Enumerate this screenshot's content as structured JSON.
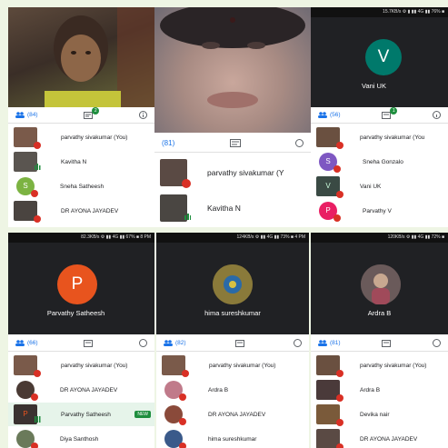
{
  "colors": {
    "meet_blue": "#1a73e8",
    "meet_green": "#1e8e3e",
    "mute_red": "#d93025",
    "avatar_teal": "#00796b",
    "avatar_orange": "#e8541e",
    "avatar_purple": "#7e57c2",
    "avatar_pink": "#e91e63",
    "avatar_lightgreen": "#7cb342"
  },
  "icons": {
    "people": "people-icon",
    "chat": "chat-icon",
    "info": "info-icon",
    "mute": "mic-off-icon",
    "talking": "audio-bars-icon"
  },
  "top_left": {
    "people_count": "(84)",
    "chat_badge": "2",
    "participants": [
      {
        "name": "parvathy sivakumar (You)",
        "status": "muted"
      },
      {
        "name": "Kavitha N",
        "status": "talking"
      },
      {
        "name": "Sneha Satheesh",
        "status": "muted",
        "initial": "S"
      },
      {
        "name": "DR AYONA JAYADEV",
        "status": "muted"
      }
    ]
  },
  "top_mid": {
    "people_count": "(81)",
    "participants": [
      {
        "name": "parvathy sivakumar (Y",
        "status": "muted"
      },
      {
        "name": "Kavitha N",
        "status": "talking"
      }
    ]
  },
  "top_right": {
    "status_bar": "15.7KB/s ⚙ ▮ ▮▮ 4G ▮▮ 76% ■",
    "video_name": "Vani UK",
    "video_initial": "V",
    "people_count": "(56)",
    "chat_badge": "1",
    "participants": [
      {
        "name": "parvathy sivakumar (You",
        "status": "muted"
      },
      {
        "name": "Sneha Gonzalo",
        "status": "muted",
        "initial": "S"
      },
      {
        "name": "Vani UK",
        "status": "muted",
        "initial": "V"
      },
      {
        "name": "Parvathy V",
        "status": "muted",
        "initial": "P"
      }
    ]
  },
  "bottom_left": {
    "status_bar": "82.3KB/s ⚙ ▮▮ 4G ▮▮ 67% ■ 8 PM",
    "video_name": "Parvathy Satheesh",
    "video_initial": "P",
    "people_count": "(66)",
    "participants": [
      {
        "name": "parvathy sivakumar (You)",
        "status": "muted"
      },
      {
        "name": "DR AYONA JAYADEV",
        "status": "muted"
      },
      {
        "name": "Parvathy Satheesh",
        "status": "talking",
        "initial": "P",
        "tag": "NEW"
      },
      {
        "name": "Diya Santhosh",
        "status": "muted"
      }
    ]
  },
  "bottom_mid": {
    "status_bar": "124KB/s ⚙ ▮▮ 4G ▮▮ 73% ■ 4 PM",
    "video_name": "hima sureshkumar",
    "people_count": "(82)",
    "participants": [
      {
        "name": "parvathy sivakumar (You)",
        "status": "muted"
      },
      {
        "name": "Ardra B",
        "status": "muted"
      },
      {
        "name": "DR AYONA JAYADEV",
        "status": "muted"
      },
      {
        "name": "hima sureshkumar",
        "status": "muted"
      }
    ]
  },
  "bottom_right": {
    "status_bar": "120KB/s ⚙ ▮▮ 4G ▮▮ 72% ■",
    "video_name": "Ardra B",
    "people_count": "(81)",
    "participants": [
      {
        "name": "parvathy sivakumar (You)",
        "status": "muted"
      },
      {
        "name": "Ardra B",
        "status": "muted"
      },
      {
        "name": "Devika nair",
        "status": "muted"
      },
      {
        "name": "DR AYONA JAYADEV",
        "status": "muted"
      }
    ]
  }
}
